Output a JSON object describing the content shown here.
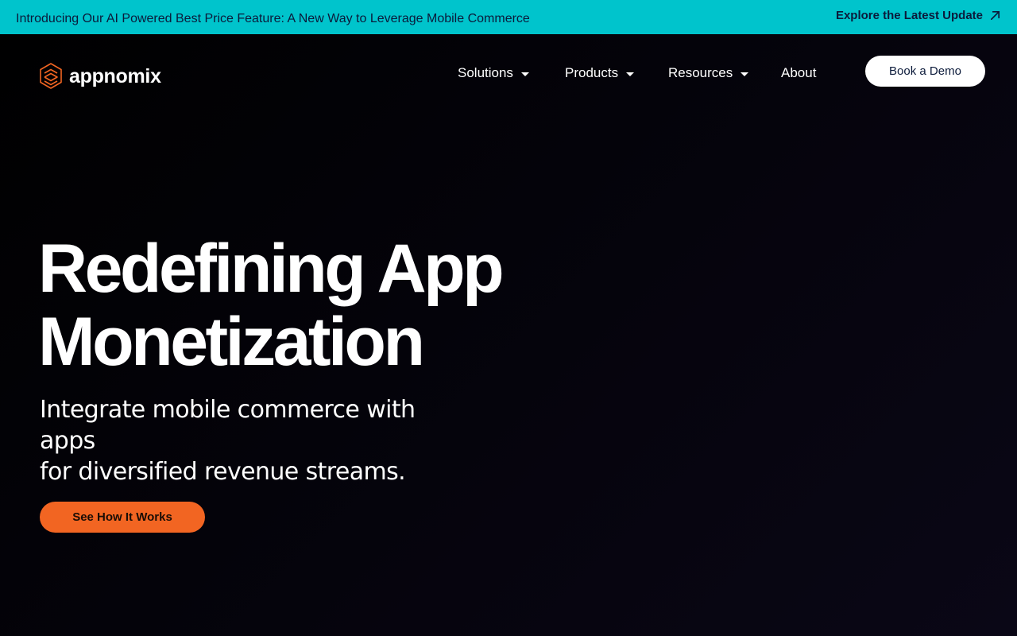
{
  "announcement": {
    "text": "Introducing Our AI Powered Best Price Feature: A New Way to Leverage Mobile Commerce",
    "link_label": "Explore the Latest Update",
    "link_icon": "arrow-up-right-icon"
  },
  "header": {
    "logo_text": "appnomix",
    "logo_icon": "hexagon-logo-icon",
    "nav": [
      {
        "label": "Solutions",
        "has_dropdown": true
      },
      {
        "label": "Products",
        "has_dropdown": true
      },
      {
        "label": "Resources",
        "has_dropdown": true
      },
      {
        "label": "About",
        "has_dropdown": false
      }
    ],
    "demo_button": "Book a Demo"
  },
  "hero": {
    "title_line1": "Redefining App",
    "title_line2": "Monetization",
    "subtitle_line1": "Integrate mobile commerce with apps",
    "subtitle_line2": "for diversified revenue streams.",
    "cta_label": "See How It Works"
  },
  "colors": {
    "announcement_bg": "#00c4cc",
    "accent": "#f26522",
    "page_bg": "#000000"
  }
}
